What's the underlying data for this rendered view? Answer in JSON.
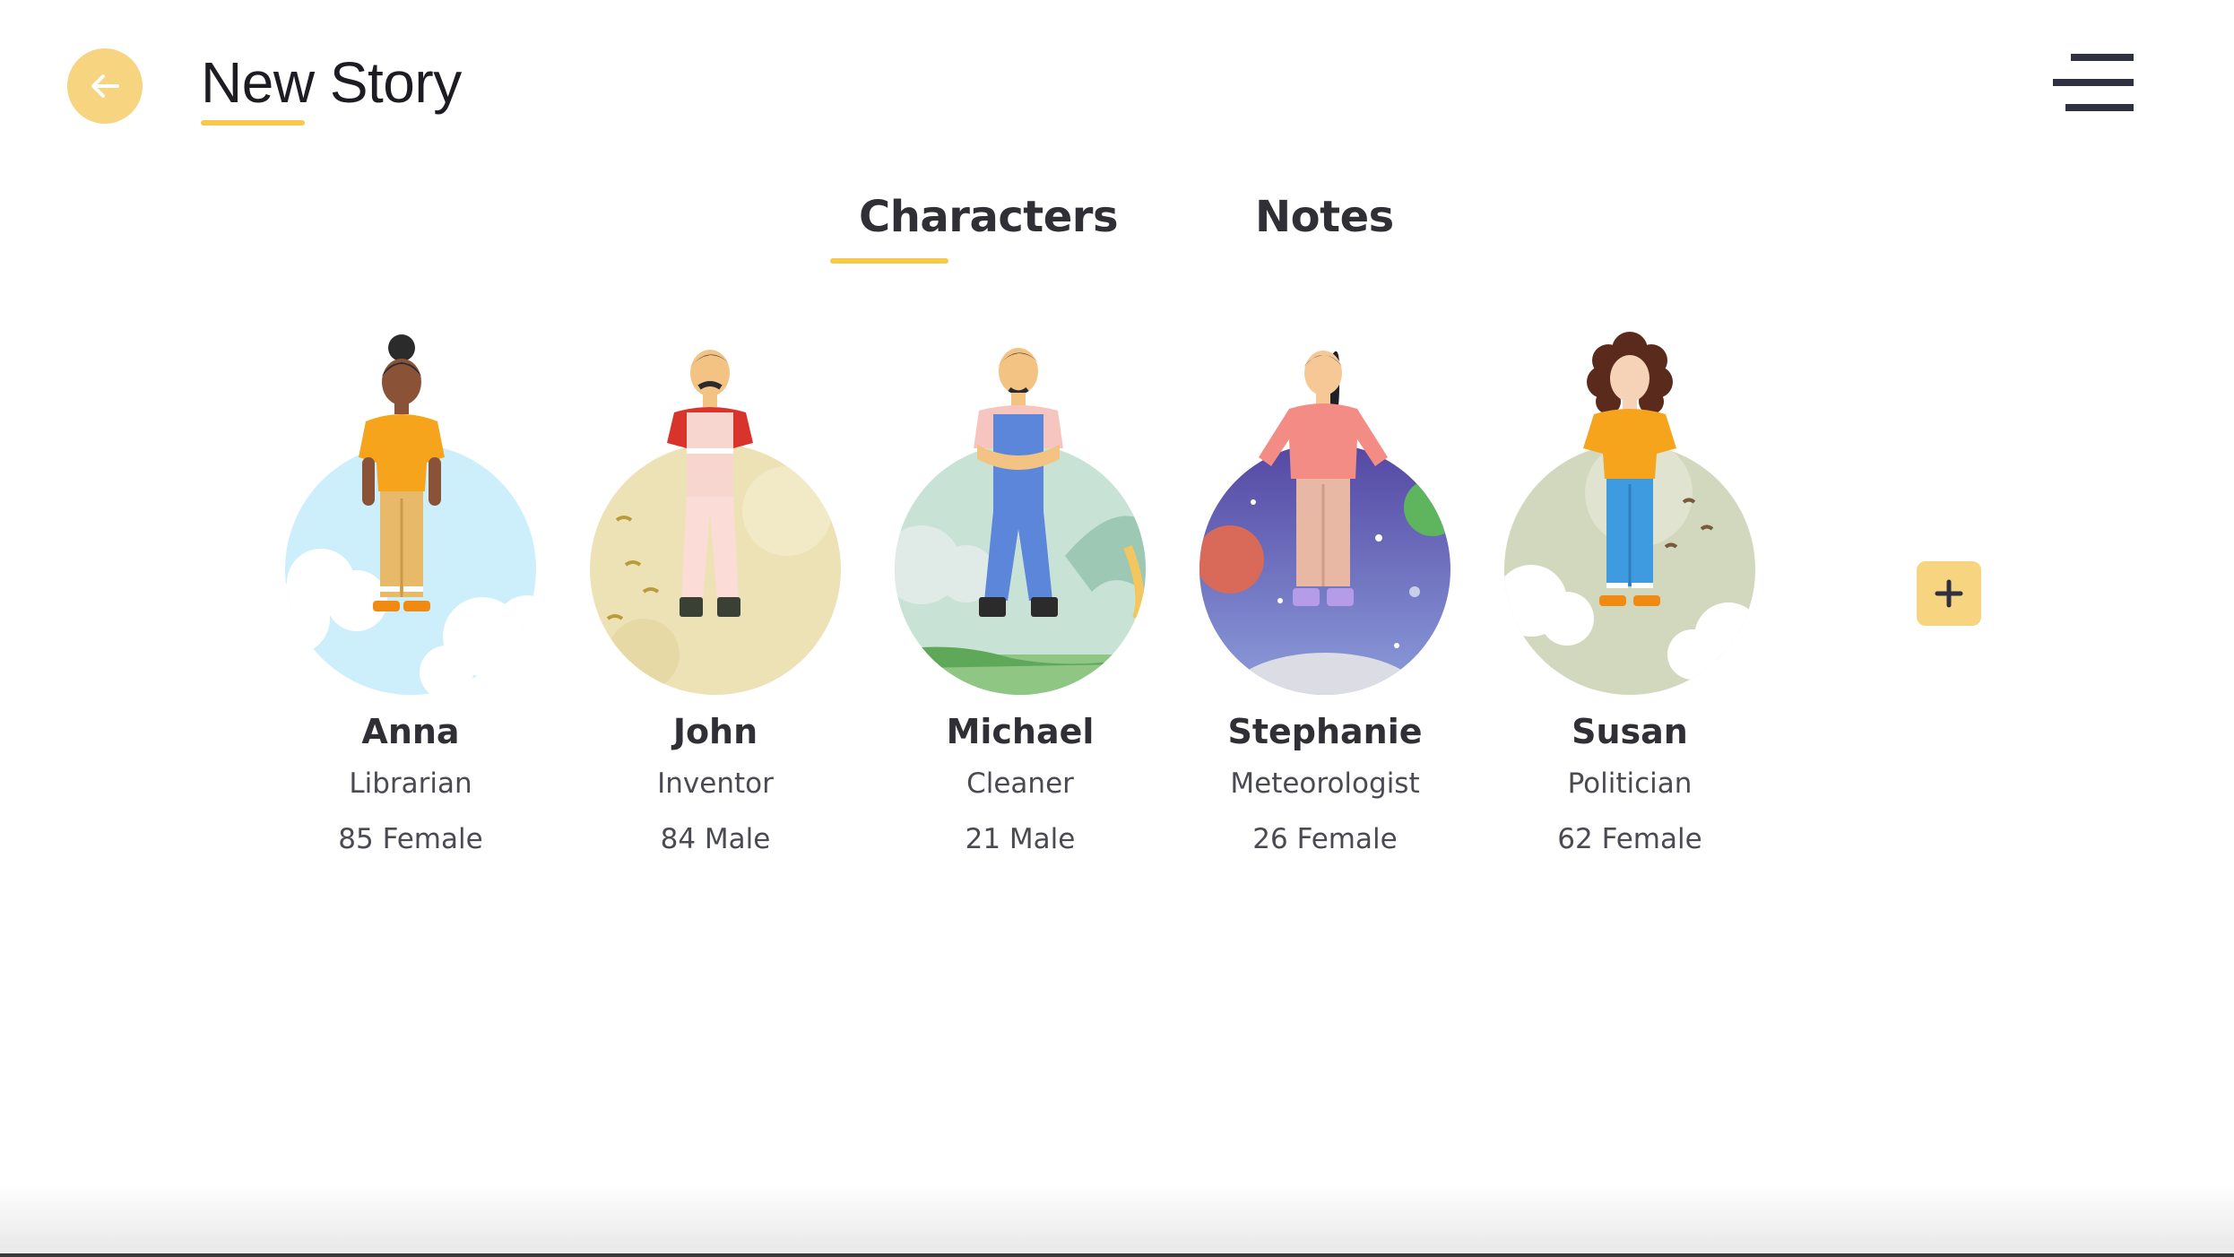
{
  "header": {
    "title": "New Story",
    "accent_color": "#f6c94a",
    "back_icon": "arrow-left-icon",
    "menu_icon": "hamburger-menu-icon"
  },
  "tabs": [
    {
      "label": "Characters",
      "active": true
    },
    {
      "label": "Notes",
      "active": false
    }
  ],
  "characters": [
    {
      "name": "Anna",
      "occupation": "Librarian",
      "meta": "85 Female",
      "backdrop": "sky"
    },
    {
      "name": "John",
      "occupation": "Inventor",
      "meta": "84 Male",
      "backdrop": "field"
    },
    {
      "name": "Michael",
      "occupation": "Cleaner",
      "meta": "21 Male",
      "backdrop": "meadow"
    },
    {
      "name": "Stephanie",
      "occupation": "Meteorologist",
      "meta": "26 Female",
      "backdrop": "space"
    },
    {
      "name": "Susan",
      "occupation": "Politician",
      "meta": "62 Female",
      "backdrop": "forest"
    }
  ],
  "add_button": {
    "icon": "plus-icon"
  }
}
